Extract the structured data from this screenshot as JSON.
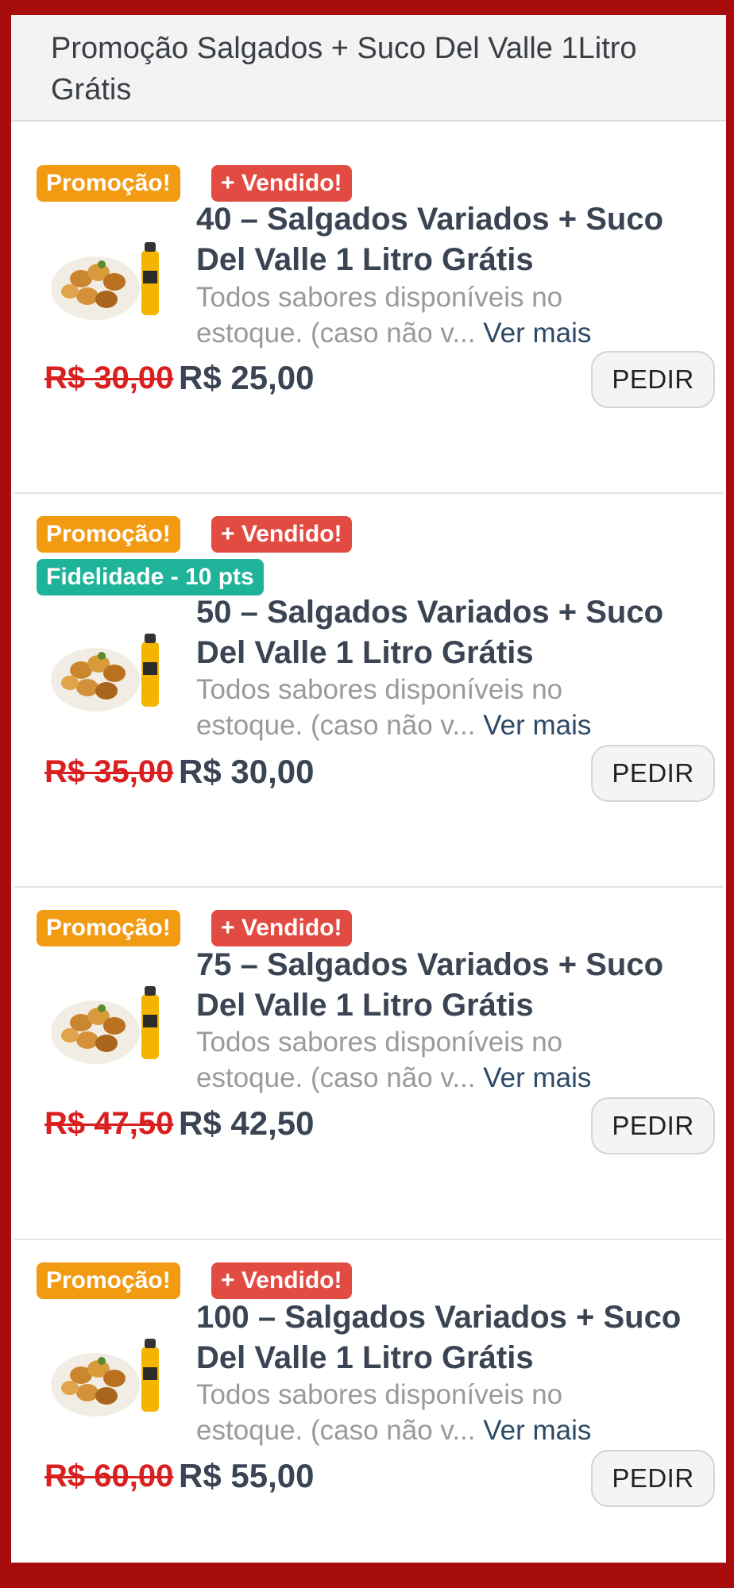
{
  "header": {
    "title": "Promoção Salgados + Suco Del Valle 1Litro Grátis"
  },
  "badges": {
    "promo": "Promoção!",
    "vendido": "+ Vendido!",
    "fidelidade": "Fidelidade - 10 pts"
  },
  "items": [
    {
      "title": "40 – Salgados Variados + Suco Del Valle 1 Litro Grátis",
      "description": "Todos sabores disponíveis no estoque. (caso não v...",
      "more_link": "Ver mais",
      "old_price": "R$ 30,00",
      "price": "R$ 25,00",
      "button": "PEDIR"
    },
    {
      "title": "50 – Salgados Variados + Suco Del Valle 1 Litro Grátis",
      "description": "Todos sabores disponíveis no estoque. (caso não v...",
      "more_link": "Ver mais",
      "old_price": "R$ 35,00",
      "price": "R$ 30,00",
      "button": "PEDIR"
    },
    {
      "title": "75 – Salgados Variados + Suco Del Valle 1 Litro Grátis",
      "description": "Todos sabores disponíveis no estoque. (caso não v...",
      "more_link": "Ver mais",
      "old_price": "R$ 47,50",
      "price": "R$ 42,50",
      "button": "PEDIR"
    },
    {
      "title": "100 – Salgados Variados + Suco Del Valle 1 Litro Grátis",
      "description": "Todos sabores disponíveis no estoque. (caso não v...",
      "more_link": "Ver mais",
      "old_price": "R$ 60,00",
      "price": "R$ 55,00",
      "button": "PEDIR"
    }
  ],
  "colors": {
    "frame": "#a80d0d",
    "promo_badge": "#f29a12",
    "vendido_badge": "#e24b42",
    "fidelidade_badge": "#1fb39a",
    "old_price": "#d91f1f",
    "link": "#2c4a66"
  },
  "icons": {
    "product_image": "salgados-and-juice-bottle-image"
  }
}
